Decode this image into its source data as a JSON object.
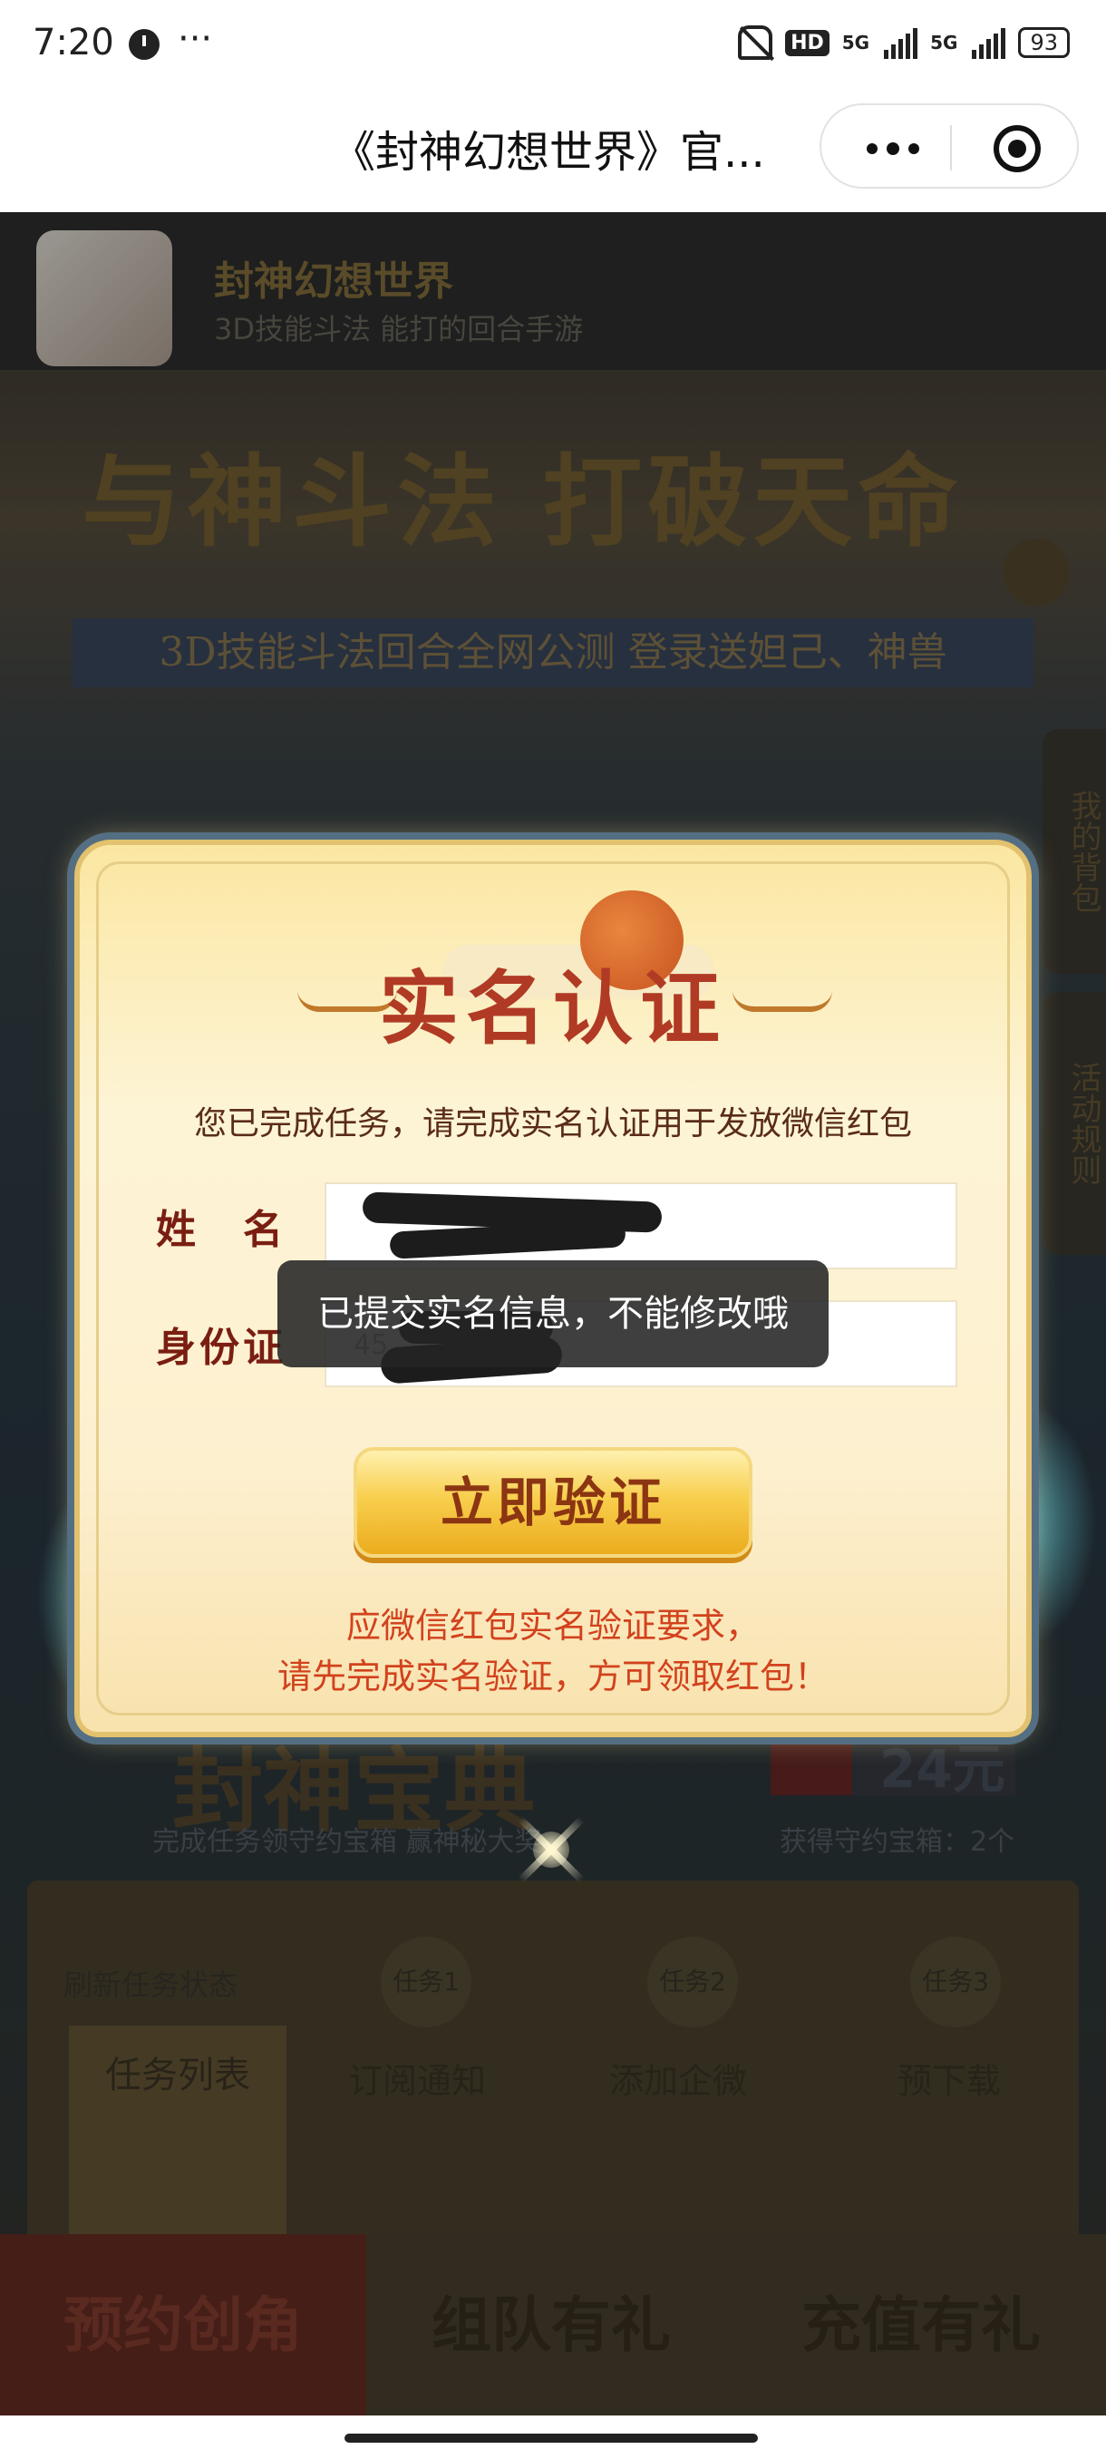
{
  "status_bar": {
    "time": "7:20",
    "more": "···",
    "hd_label": "HD",
    "net1": "5G",
    "net2": "5G",
    "battery": "93"
  },
  "titlebar": {
    "title": "《封神幻想世界》官...",
    "more_icon": "more-dots-icon",
    "close_icon": "close-miniprogram-icon"
  },
  "game": {
    "name": "封神幻想世界",
    "subtitle": "3D技能斗法 能打的回合手游",
    "slogan": "与神斗法 打破天命",
    "slogan_sub": "3D技能斗法回合全网公测 登录送妲己、神兽",
    "side_tabs": [
      "我的背包",
      "活动规则"
    ],
    "treasure_title": "封神宝典",
    "treasure_desc": "完成任务领守约宝箱 赢神秘大奖",
    "chest_count_num": "24元",
    "chest_count_text": "获得守约宝箱：2个",
    "refresh": "刷新任务状态",
    "tasks": [
      "任务1",
      "任务2",
      "任务3"
    ],
    "task_list_title": "任务列表",
    "task_items": [
      "订阅通知",
      "添加企微",
      "预下载"
    ],
    "bottom_nav": [
      "预约创角",
      "组队有礼",
      "充值有礼"
    ]
  },
  "modal": {
    "heading": "实名认证",
    "intro": "您已完成任务，请完成实名认证用于发放微信红包",
    "name_label": "姓　名",
    "id_label": "身份证",
    "name_value": "",
    "id_value_visible": "45",
    "submit": "立即验证",
    "note_line1": "应微信红包实名验证要求，",
    "note_line2": "请先完成实名验证，方可领取红包！"
  },
  "toast": {
    "message": "已提交实名信息，不能修改哦"
  },
  "colors": {
    "heading_red": "#b03a24",
    "note_red": "#d2421d",
    "button_gold": "#f8cf4e",
    "modal_bg": "#fdf4d6"
  }
}
